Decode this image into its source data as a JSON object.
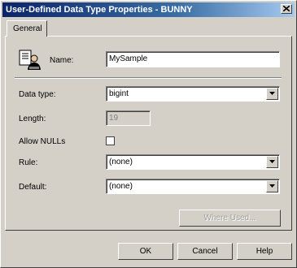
{
  "window": {
    "title": "User-Defined Data Type Properties - BUNNY",
    "close_label": "close"
  },
  "tabs": [
    {
      "label": "General",
      "selected": true
    }
  ],
  "form": {
    "name_label": "Name:",
    "name_value": "MySample",
    "data_type_label": "Data type:",
    "data_type_value": "bigint",
    "length_label": "Length:",
    "length_value": "19",
    "allow_nulls_label": "Allow NULLs",
    "allow_nulls_checked": false,
    "rule_label": "Rule:",
    "rule_value": "(none)",
    "default_label": "Default:",
    "default_value": "(none)",
    "where_used_label": "Where Used..."
  },
  "buttons": {
    "ok": "OK",
    "cancel": "Cancel",
    "help": "Help"
  },
  "icons": {
    "data_type": "user-defined-type-icon",
    "close": "close-icon",
    "dropdown": "chevron-down-icon"
  }
}
